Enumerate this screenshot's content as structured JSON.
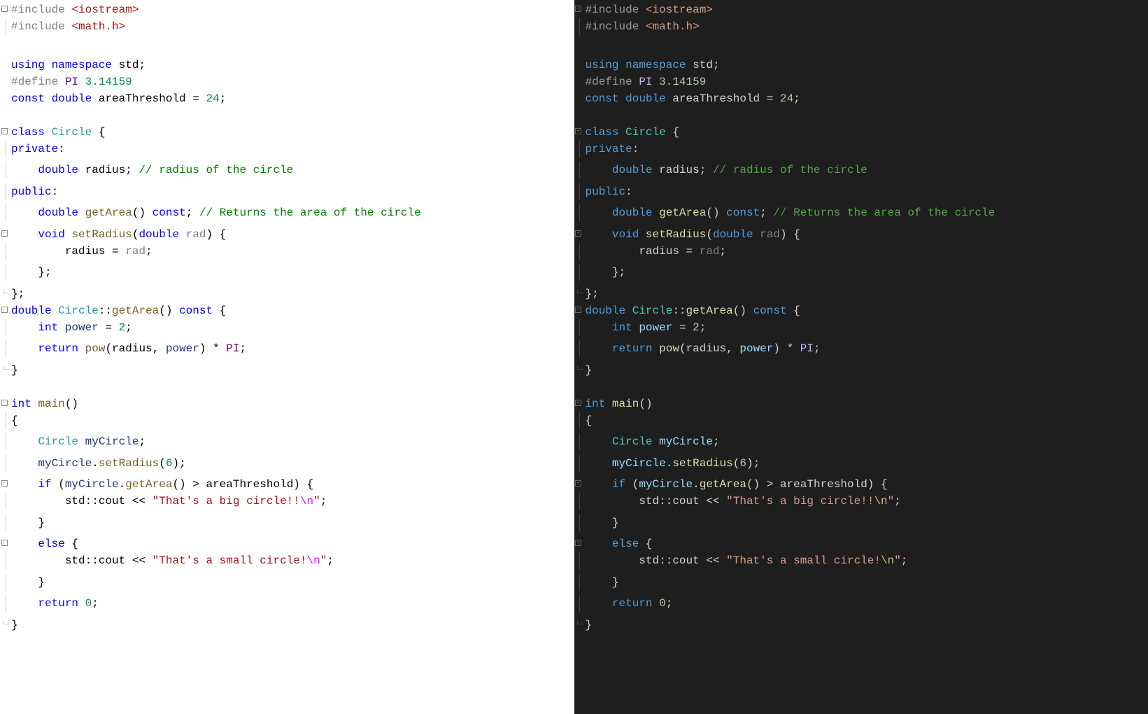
{
  "panes": [
    {
      "theme": "light"
    },
    {
      "theme": "dark"
    }
  ],
  "code": {
    "lines": [
      {
        "fold": "-",
        "tokens": [
          [
            "pre",
            "#include "
          ],
          [
            "inc",
            "<iostream>"
          ]
        ]
      },
      {
        "fold": "|",
        "tokens": [
          [
            "pre",
            "#include "
          ],
          [
            "inc",
            "<math.h>"
          ]
        ]
      },
      {
        "fold": "",
        "tokens": []
      },
      {
        "fold": "",
        "tokens": [
          [
            "kw",
            "using "
          ],
          [
            "kw",
            "namespace "
          ],
          [
            "ident",
            "std"
          ],
          [
            "op",
            ";"
          ]
        ]
      },
      {
        "fold": "",
        "tokens": [
          [
            "pre",
            "#define "
          ],
          [
            "macro",
            "PI"
          ],
          [
            "op",
            " "
          ],
          [
            "num",
            "3.14159"
          ]
        ]
      },
      {
        "fold": "",
        "tokens": [
          [
            "kw",
            "const "
          ],
          [
            "kw",
            "double "
          ],
          [
            "ident",
            "areaThreshold"
          ],
          [
            "op",
            " = "
          ],
          [
            "num",
            "24"
          ],
          [
            "op",
            ";"
          ]
        ]
      },
      {
        "fold": "",
        "tokens": []
      },
      {
        "fold": "-",
        "tokens": [
          [
            "kw",
            "class "
          ],
          [
            "type",
            "Circle"
          ],
          [
            "op",
            " {"
          ]
        ]
      },
      {
        "fold": "|",
        "tokens": [
          [
            "kw",
            "private"
          ],
          [
            "op",
            ":"
          ]
        ]
      },
      {
        "fold": "|",
        "tokens": [
          [
            "op",
            "    "
          ],
          [
            "kw",
            "double "
          ],
          [
            "ident",
            "radius"
          ],
          [
            "op",
            "; "
          ],
          [
            "com",
            "// radius of the circle"
          ]
        ]
      },
      {
        "fold": "|",
        "tokens": [
          [
            "kw",
            "public"
          ],
          [
            "op",
            ":"
          ]
        ]
      },
      {
        "fold": "|",
        "tokens": [
          [
            "op",
            "    "
          ],
          [
            "kw",
            "double "
          ],
          [
            "func",
            "getArea"
          ],
          [
            "op",
            "() "
          ],
          [
            "kw",
            "const"
          ],
          [
            "op",
            "; "
          ],
          [
            "com",
            "// Returns the area of the circle"
          ]
        ]
      },
      {
        "fold": "-",
        "tokens": [
          [
            "op",
            "    "
          ],
          [
            "kw",
            "void "
          ],
          [
            "func",
            "setRadius"
          ],
          [
            "op",
            "("
          ],
          [
            "kw",
            "double "
          ],
          [
            "param",
            "rad"
          ],
          [
            "op",
            ") {"
          ]
        ]
      },
      {
        "fold": "|",
        "tokens": [
          [
            "op",
            "        "
          ],
          [
            "ident",
            "radius"
          ],
          [
            "op",
            " = "
          ],
          [
            "param",
            "rad"
          ],
          [
            "op",
            ";"
          ]
        ]
      },
      {
        "fold": "|",
        "tokens": [
          [
            "op",
            "    };"
          ]
        ]
      },
      {
        "fold": "L",
        "tokens": [
          [
            "op",
            "};"
          ]
        ]
      },
      {
        "fold": "-",
        "tokens": [
          [
            "kw",
            "double "
          ],
          [
            "type",
            "Circle"
          ],
          [
            "op",
            "::"
          ],
          [
            "func",
            "getArea"
          ],
          [
            "op",
            "() "
          ],
          [
            "kw",
            "const"
          ],
          [
            "op",
            " {"
          ]
        ]
      },
      {
        "fold": "|",
        "tokens": [
          [
            "op",
            "    "
          ],
          [
            "kw",
            "int "
          ],
          [
            "local",
            "power"
          ],
          [
            "op",
            " = "
          ],
          [
            "num",
            "2"
          ],
          [
            "op",
            ";"
          ]
        ]
      },
      {
        "fold": "|",
        "tokens": [
          [
            "op",
            "    "
          ],
          [
            "kw",
            "return "
          ],
          [
            "func",
            "pow"
          ],
          [
            "op",
            "("
          ],
          [
            "ident",
            "radius"
          ],
          [
            "op",
            ", "
          ],
          [
            "local",
            "power"
          ],
          [
            "op",
            ") * "
          ],
          [
            "macro",
            "PI"
          ],
          [
            "op",
            ";"
          ]
        ]
      },
      {
        "fold": "L",
        "tokens": [
          [
            "op",
            "}"
          ]
        ]
      },
      {
        "fold": "",
        "tokens": []
      },
      {
        "fold": "-",
        "tokens": [
          [
            "kw",
            "int "
          ],
          [
            "func",
            "main"
          ],
          [
            "op",
            "()"
          ]
        ]
      },
      {
        "fold": "|",
        "tokens": [
          [
            "op",
            "{"
          ]
        ]
      },
      {
        "fold": "|",
        "tokens": [
          [
            "op",
            "    "
          ],
          [
            "type",
            "Circle"
          ],
          [
            "op",
            " "
          ],
          [
            "local",
            "myCircle"
          ],
          [
            "op",
            ";"
          ]
        ]
      },
      {
        "fold": "|",
        "tokens": [
          [
            "op",
            "    "
          ],
          [
            "local",
            "myCircle"
          ],
          [
            "op",
            "."
          ],
          [
            "func",
            "setRadius"
          ],
          [
            "op",
            "("
          ],
          [
            "num",
            "6"
          ],
          [
            "op",
            ");"
          ]
        ]
      },
      {
        "fold": "-",
        "tokens": [
          [
            "op",
            "    "
          ],
          [
            "kw",
            "if"
          ],
          [
            "op",
            " ("
          ],
          [
            "local",
            "myCircle"
          ],
          [
            "op",
            "."
          ],
          [
            "func",
            "getArea"
          ],
          [
            "op",
            "() > "
          ],
          [
            "ident",
            "areaThreshold"
          ],
          [
            "op",
            ") {"
          ]
        ]
      },
      {
        "fold": "|",
        "tokens": [
          [
            "op",
            "        "
          ],
          [
            "ident",
            "std"
          ],
          [
            "op",
            "::"
          ],
          [
            "ident",
            "cout"
          ],
          [
            "op",
            " << "
          ],
          [
            "str",
            "\"That's a big circle!!"
          ],
          [
            "esc",
            "\\n"
          ],
          [
            "str",
            "\""
          ],
          [
            "op",
            ";"
          ]
        ]
      },
      {
        "fold": "|",
        "tokens": [
          [
            "op",
            "    }"
          ]
        ]
      },
      {
        "fold": "-",
        "tokens": [
          [
            "op",
            "    "
          ],
          [
            "kw",
            "else"
          ],
          [
            "op",
            " {"
          ]
        ]
      },
      {
        "fold": "|",
        "tokens": [
          [
            "op",
            "        "
          ],
          [
            "ident",
            "std"
          ],
          [
            "op",
            "::"
          ],
          [
            "ident",
            "cout"
          ],
          [
            "op",
            " << "
          ],
          [
            "str",
            "\"That's a small circle!"
          ],
          [
            "esc",
            "\\n"
          ],
          [
            "str",
            "\""
          ],
          [
            "op",
            ";"
          ]
        ]
      },
      {
        "fold": "|",
        "tokens": [
          [
            "op",
            "    }"
          ]
        ]
      },
      {
        "fold": "|",
        "tokens": [
          [
            "op",
            "    "
          ],
          [
            "kw",
            "return "
          ],
          [
            "num",
            "0"
          ],
          [
            "op",
            ";"
          ]
        ]
      },
      {
        "fold": "L",
        "tokens": [
          [
            "op",
            "}"
          ]
        ]
      }
    ]
  }
}
